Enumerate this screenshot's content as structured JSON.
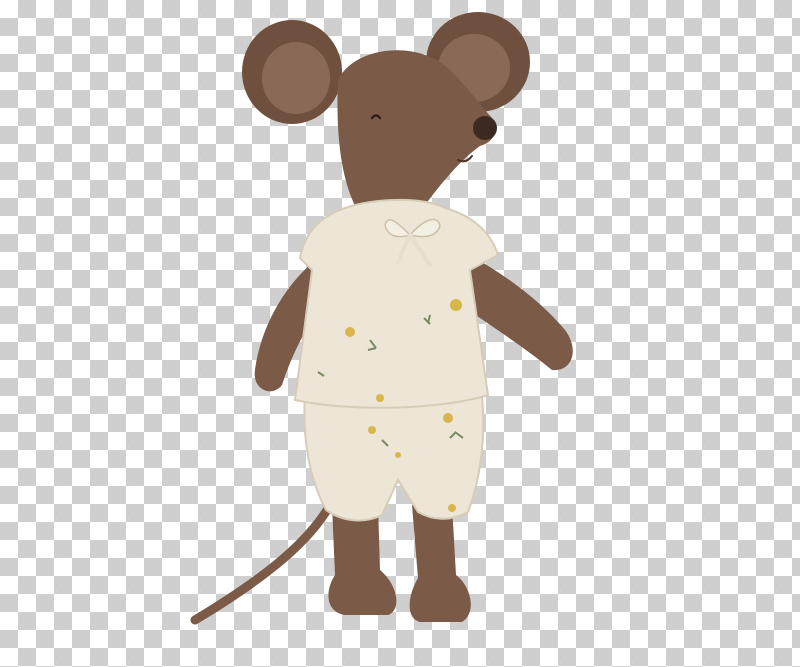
{
  "image": {
    "subject": "plush-mouse-toy",
    "background": "transparency-checkerboard",
    "colors": {
      "checker_light": "#ffffff",
      "checker_dark": "#cfcfcf",
      "fur": "#7b5a47",
      "fur_shadow": "#5e4333",
      "ear_inner": "#8a6a57",
      "nose": "#3b2a22",
      "fabric": "#ede6d6",
      "fabric_shadow": "#d6ccb8",
      "flower_yellow": "#d9b64c",
      "leaf_green": "#7b8a63"
    }
  }
}
